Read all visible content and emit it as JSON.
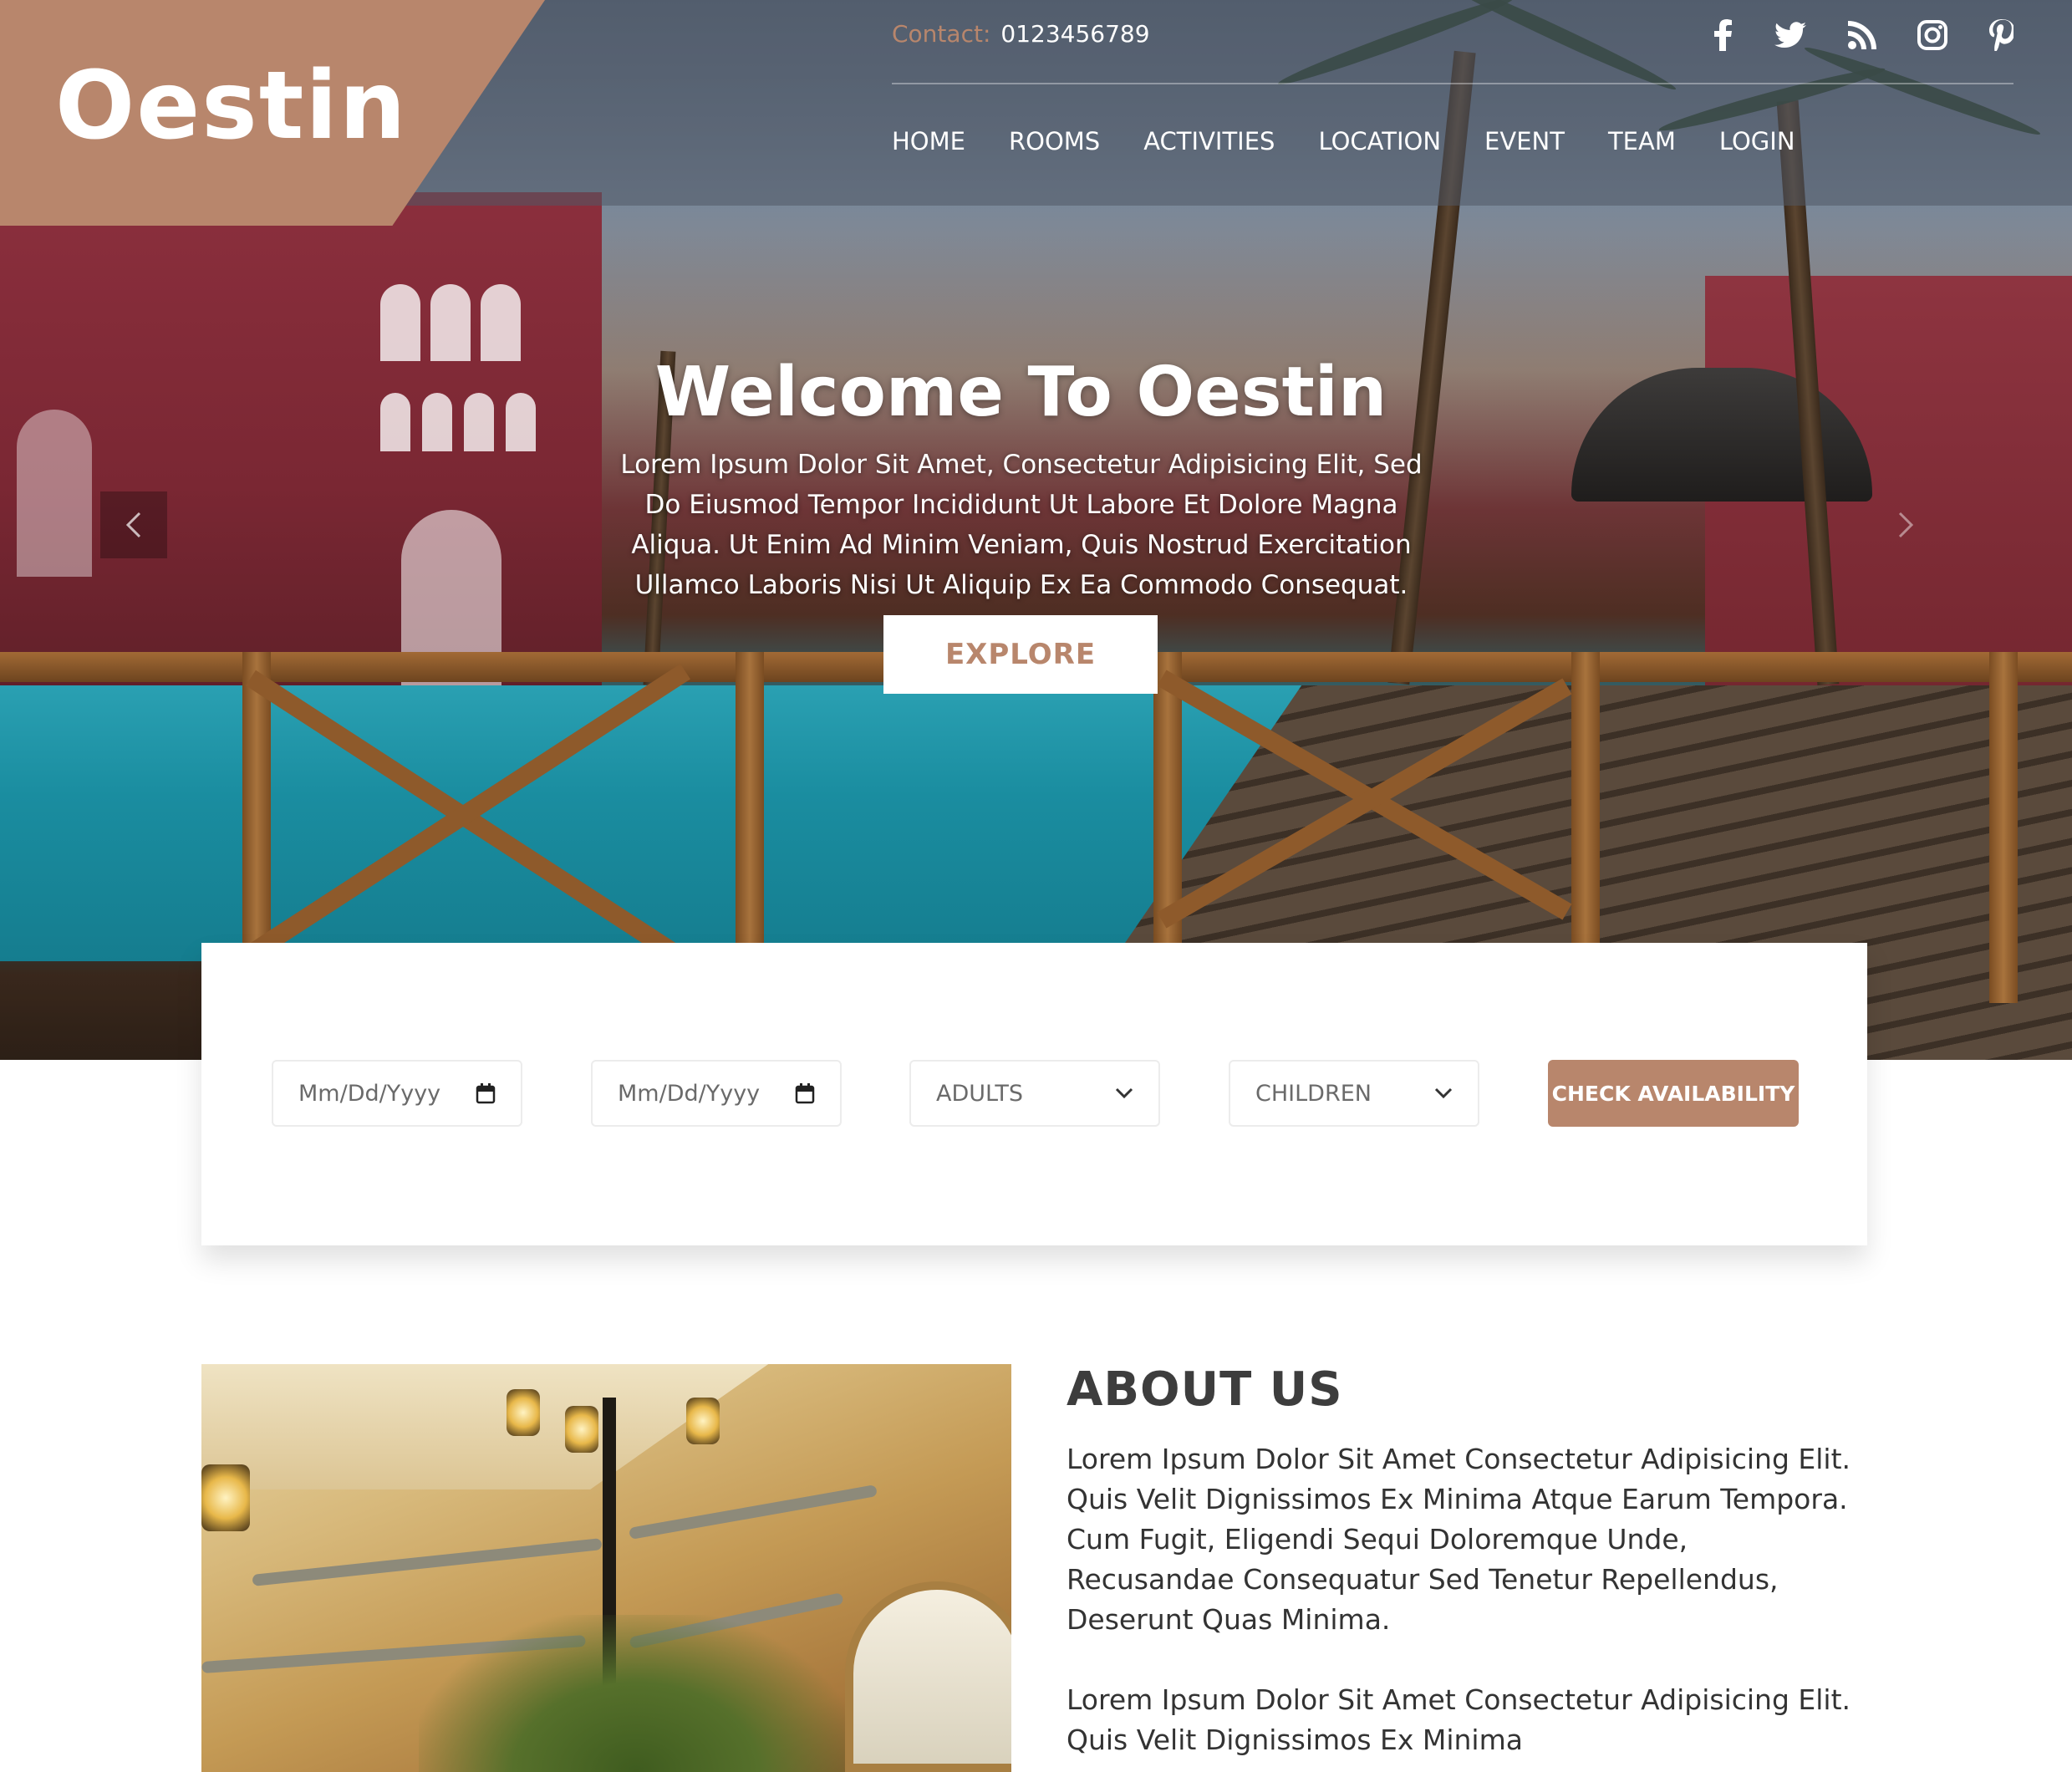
{
  "brand": {
    "name": "Oestin",
    "accent": "#b8866c"
  },
  "contact": {
    "label": "Contact:",
    "phone": "0123456789"
  },
  "social": [
    "facebook-icon",
    "twitter-icon",
    "rss-icon",
    "instagram-icon",
    "pinterest-icon"
  ],
  "nav": {
    "items": [
      "HOME",
      "ROOMS",
      "ACTIVITIES",
      "LOCATION",
      "EVENT",
      "TEAM",
      "LOGIN"
    ]
  },
  "hero": {
    "title": "Welcome To Oestin",
    "text": "Lorem Ipsum Dolor Sit Amet, Consectetur Adipisicing Elit, Sed Do Eiusmod Tempor Incididunt Ut Labore Et Dolore Magna Aliqua. Ut Enim Ad Minim Veniam, Quis Nostrud Exercitation Ullamco Laboris Nisi Ut Aliquip Ex Ea Commodo Consequat.",
    "cta": "EXPLORE"
  },
  "booking": {
    "checkin_placeholder": "Mm/Dd/Yyyy",
    "checkout_placeholder": "Mm/Dd/Yyyy",
    "adults": "ADULTS",
    "children": "CHILDREN",
    "submit": "CHECK AVAILABILITY"
  },
  "about": {
    "title": "ABOUT US",
    "p1": "Lorem Ipsum Dolor Sit Amet Consectetur Adipisicing Elit. Quis Velit Dignissimos Ex Minima Atque Earum Tempora. Cum Fugit, Eligendi Sequi Doloremque Unde, Recusandae Consequatur Sed Tenetur Repellendus, Deserunt Quas Minima.",
    "p2": "Lorem Ipsum Dolor Sit Amet Consectetur Adipisicing Elit. Quis Velit Dignissimos Ex Minima"
  }
}
